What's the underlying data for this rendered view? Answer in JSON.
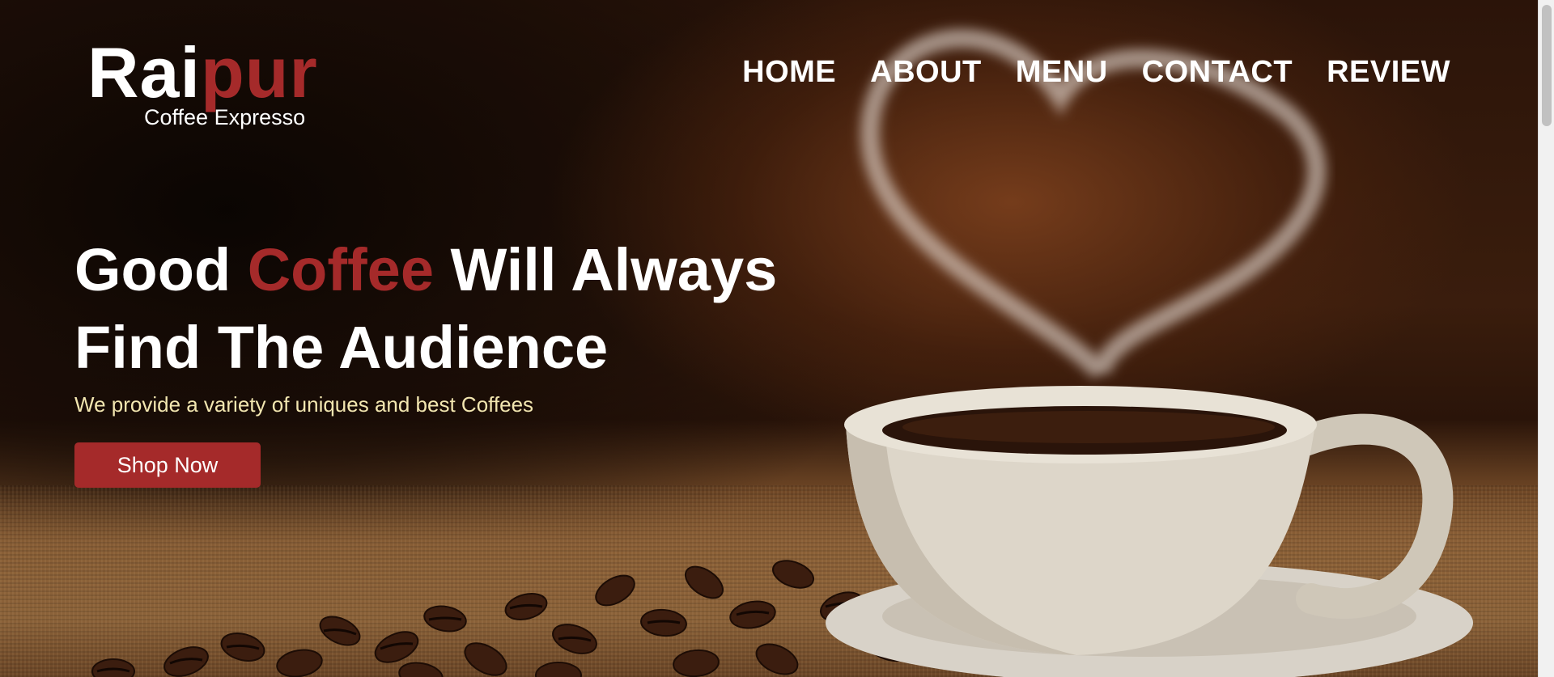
{
  "logo": {
    "name_part1": "Rai",
    "name_part2": "pur",
    "tagline": "Coffee Expresso"
  },
  "nav": [
    {
      "label": "HOME"
    },
    {
      "label": "ABOUT"
    },
    {
      "label": "MENU"
    },
    {
      "label": "CONTACT"
    },
    {
      "label": "REVIEW"
    }
  ],
  "hero": {
    "headline_start": "Good ",
    "headline_accent": "Coffee",
    "headline_rest": " Will Always",
    "headline_line2": "Find The Audience",
    "subtext": "We provide a variety of uniques and best Coffees",
    "cta_label": "Shop Now"
  },
  "colors": {
    "accent": "#a52a2a",
    "subtext": "#f2e6b0",
    "text": "#ffffff"
  }
}
